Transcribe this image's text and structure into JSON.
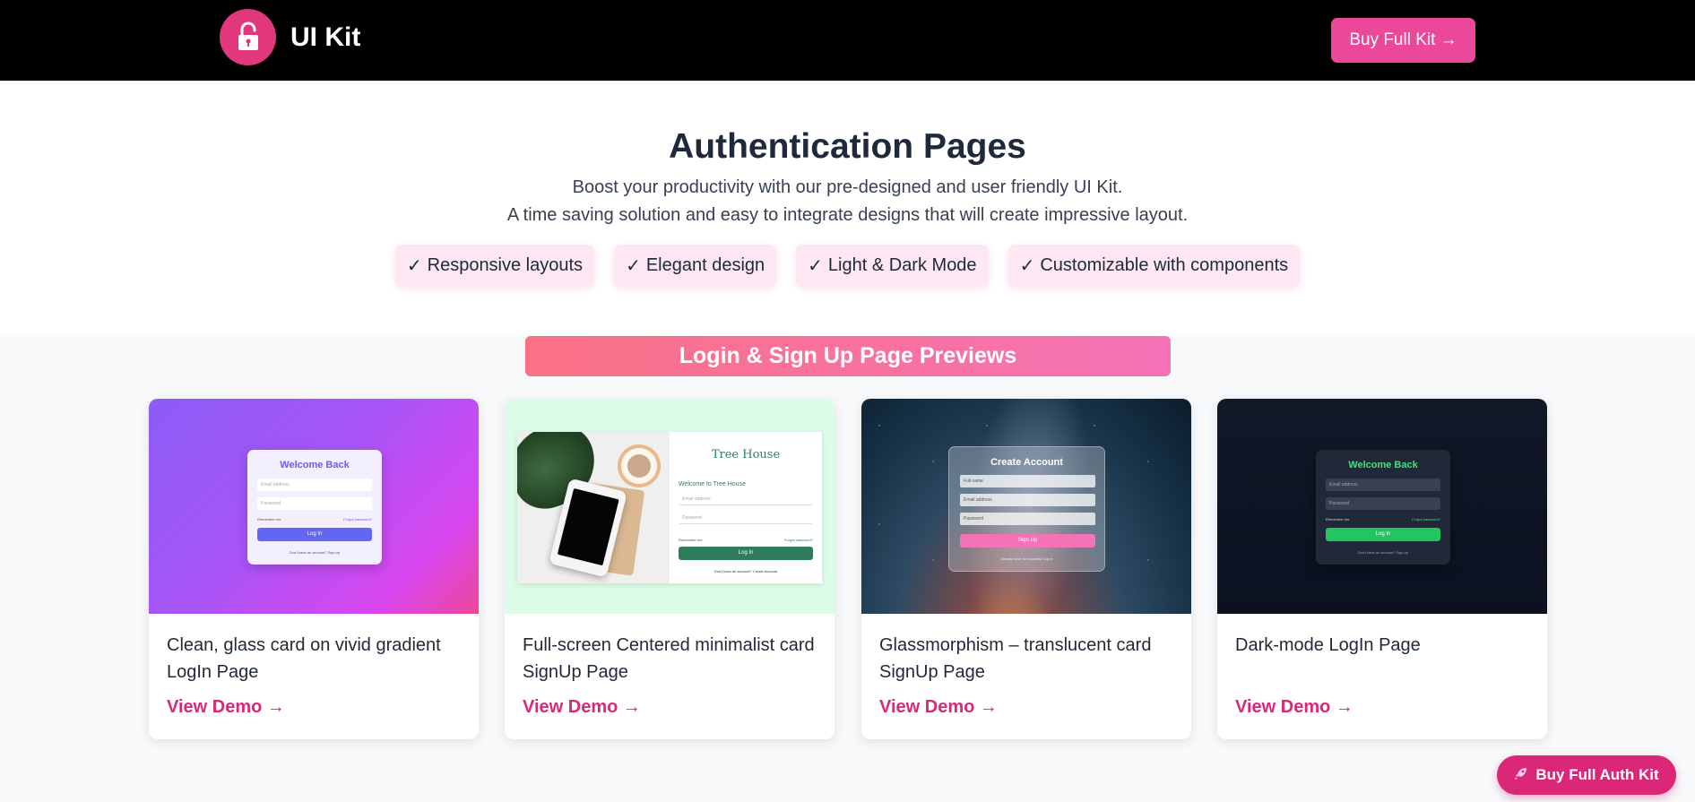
{
  "header": {
    "brand_name": "UI Kit",
    "buy_button_label": "Buy Full Kit →"
  },
  "hero": {
    "title": "Authentication Pages",
    "subtitle_line1": "Boost your productivity with our pre-designed and user friendly UI Kit.",
    "subtitle_line2": "A time saving solution and easy to integrate designs that will create impressive layout.",
    "features": [
      {
        "check": "✓",
        "label": "Responsive layouts"
      },
      {
        "check": "✓",
        "label": "Elegant design"
      },
      {
        "check": "✓",
        "label": "Light & Dark Mode"
      },
      {
        "check": "✓",
        "label": "Customizable with components"
      }
    ]
  },
  "section": {
    "title": "Login & Sign Up Page Previews"
  },
  "cards": [
    {
      "preview_title": "Welcome Back",
      "desc_line1": "Clean, glass card on vivid gradient",
      "desc_line2": "LogIn Page",
      "link_label": "View Demo →",
      "fields": [
        "Email address",
        "Password"
      ],
      "remember": "Remember me",
      "forgot": "Forgot password?",
      "button": "Log In",
      "footer": "Don't have an account? Sign up"
    },
    {
      "preview_title": "Tree House",
      "welcome": "Welcome to Tree House",
      "desc_line1": "Full-screen Centered minimalist card",
      "desc_line2": "SignUp Page",
      "link_label": "View Demo →",
      "fields": [
        "Email address",
        "Password"
      ],
      "remember": "Remember me",
      "forgot": "Forgot password?",
      "button": "Log In",
      "footer": "Don't have an account? Create Account"
    },
    {
      "preview_title": "Create Account",
      "desc_line1": "Glassmorphism – translucent card",
      "desc_line2": "SignUp Page",
      "link_label": "View Demo →",
      "fields": [
        "Full name",
        "Email address",
        "Password"
      ],
      "button": "Sign Up",
      "footer": "Already have an account? Log in"
    },
    {
      "preview_title": "Welcome Back",
      "desc_line1": "Dark-mode LogIn Page",
      "desc_line2": "",
      "link_label": "View Demo →",
      "fields": [
        "Email address",
        "Password"
      ],
      "remember": "Remember me",
      "forgot": "Forgot password?",
      "button": "Log In",
      "footer": "Don't have an account? Sign up"
    }
  ],
  "floating_button": {
    "icon": "rocket-icon",
    "label": "Buy Full Auth Kit"
  },
  "colors": {
    "accent": "#ec4899",
    "link": "#db2777",
    "header_bg": "#000000",
    "feature_bg": "#fce7f3"
  }
}
